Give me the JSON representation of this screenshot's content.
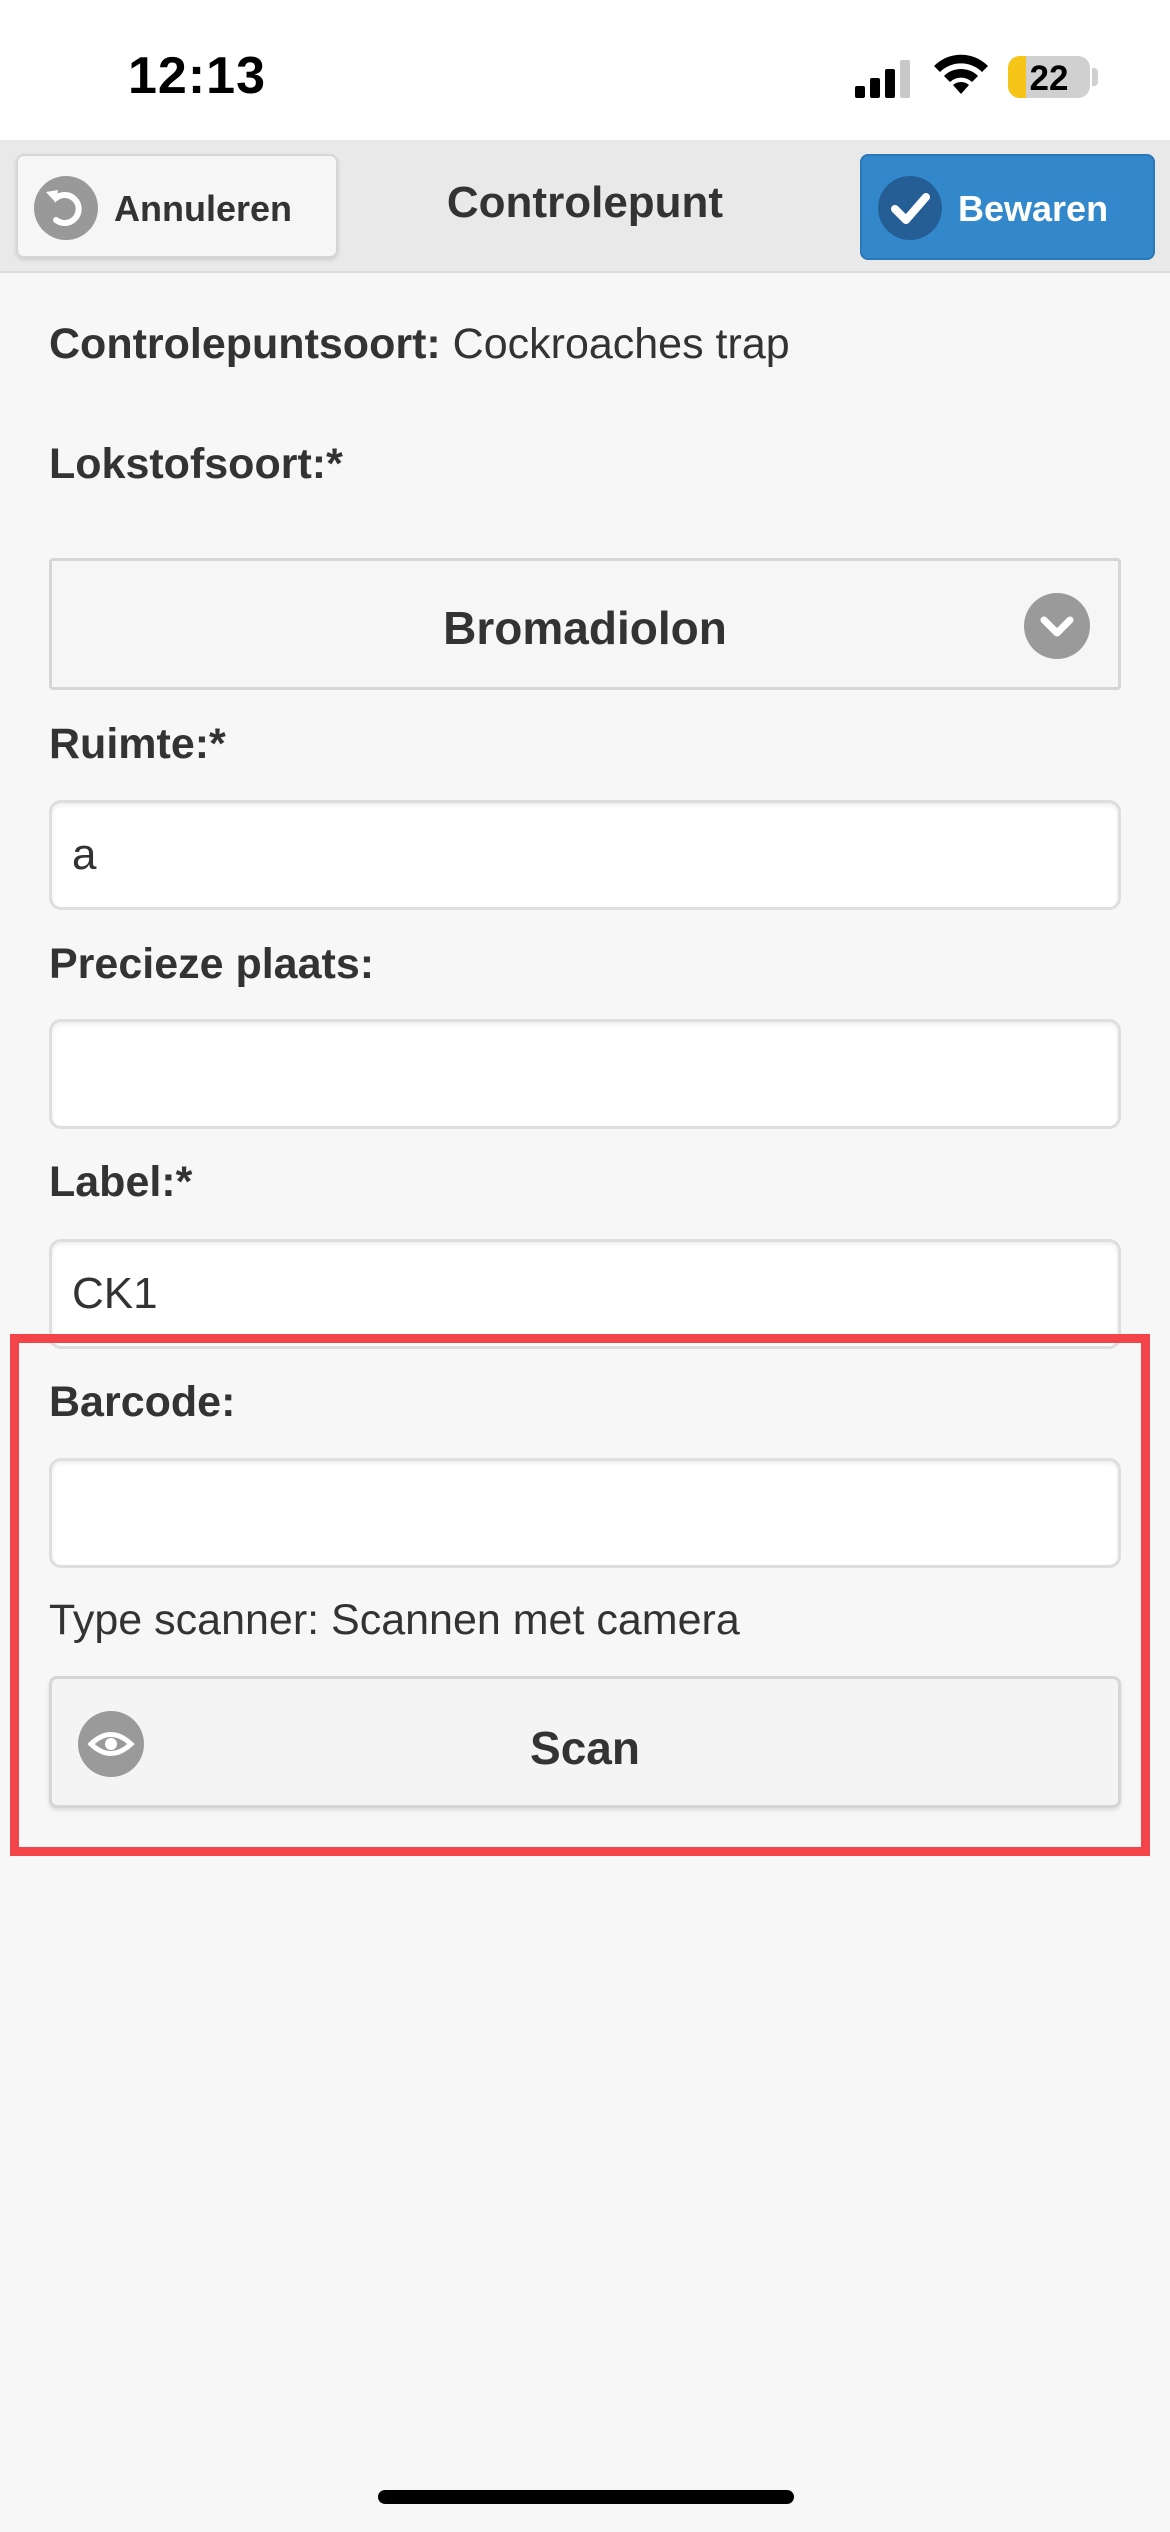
{
  "status_bar": {
    "time": "12:13",
    "battery_level": "22",
    "battery_fill_fraction": 0.22,
    "icons": [
      "cellular-signal-icon",
      "wifi-icon",
      "battery-icon"
    ]
  },
  "header": {
    "cancel_label": "Annuleren",
    "cancel_icon": "undo-arrow-icon",
    "title": "Controlepunt",
    "save_label": "Bewaren",
    "save_icon": "checkmark-icon"
  },
  "form": {
    "type_label": "Controlepuntsoort:",
    "type_value": "Cockroaches trap",
    "bait_label": "Lokstofsoort:*",
    "bait_value": "Bromadiolon",
    "room_label": "Ruimte:*",
    "room_value": "a",
    "place_label": "Precieze plaats:",
    "place_value": "",
    "tag_label": "Label:*",
    "tag_value": "CK1",
    "barcode_label": "Barcode:",
    "barcode_value": "",
    "scanner_note": "Type scanner: Scannen met camera",
    "scan_label": "Scan",
    "scan_icon": "eye-icon"
  },
  "colors": {
    "primary": "#3388cc",
    "highlight": "#f24449",
    "background": "#f7f7f7",
    "battery_low": "#f5c518"
  }
}
